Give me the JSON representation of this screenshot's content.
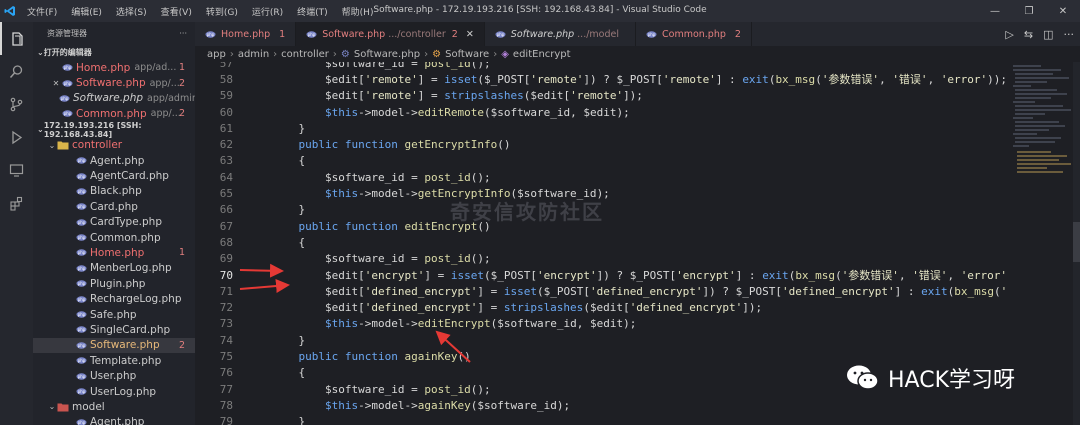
{
  "titlebar": {
    "menu": [
      "文件(F)",
      "编辑(E)",
      "选择(S)",
      "查看(V)",
      "转到(G)",
      "运行(R)",
      "终端(T)",
      "帮助(H)"
    ],
    "title": "Software.php - 172.19.193.216 [SSH: 192.168.43.84] - Visual Studio Code"
  },
  "sidebar": {
    "header": "资源管理器",
    "open_editors_label": "打开的编辑器",
    "open_editors": [
      {
        "name": "Home.php",
        "path": "app/ad...",
        "badge": "1",
        "state": "err"
      },
      {
        "name": "Software.php",
        "path": "app/...",
        "badge": "2",
        "state": "err",
        "close": "✕"
      },
      {
        "name": "Software.php",
        "path": "app/admin...",
        "badge": "",
        "state": "italic"
      },
      {
        "name": "Common.php",
        "path": "app/...",
        "badge": "2",
        "state": "err"
      }
    ],
    "workspace_label": "172.19.193.216 [SSH: 192.168.43.84]",
    "folder_controller": "controller",
    "files": [
      {
        "name": "Agent.php",
        "badge": "",
        "state": ""
      },
      {
        "name": "AgentCard.php",
        "badge": "",
        "state": ""
      },
      {
        "name": "Black.php",
        "badge": "",
        "state": ""
      },
      {
        "name": "Card.php",
        "badge": "",
        "state": ""
      },
      {
        "name": "CardType.php",
        "badge": "",
        "state": ""
      },
      {
        "name": "Common.php",
        "badge": "",
        "state": ""
      },
      {
        "name": "Home.php",
        "badge": "1",
        "state": "err"
      },
      {
        "name": "MenberLog.php",
        "badge": "",
        "state": ""
      },
      {
        "name": "Plugin.php",
        "badge": "",
        "state": ""
      },
      {
        "name": "RechargeLog.php",
        "badge": "",
        "state": ""
      },
      {
        "name": "Safe.php",
        "badge": "",
        "state": ""
      },
      {
        "name": "SingleCard.php",
        "badge": "",
        "state": ""
      },
      {
        "name": "Software.php",
        "badge": "2",
        "state": "mod sel"
      },
      {
        "name": "Template.php",
        "badge": "",
        "state": ""
      },
      {
        "name": "User.php",
        "badge": "",
        "state": ""
      },
      {
        "name": "UserLog.php",
        "badge": "",
        "state": ""
      }
    ],
    "folder_model": "model",
    "model_files": [
      {
        "name": "Agent.php",
        "badge": "",
        "state": ""
      }
    ]
  },
  "tabs": [
    {
      "name": "Home.php",
      "path": "",
      "num": "1",
      "active": false
    },
    {
      "name": "Software.php",
      "path": ".../controller",
      "num": "2",
      "active": true
    },
    {
      "name": "Software.php",
      "path": ".../model",
      "num": "",
      "active": false
    },
    {
      "name": "Common.php",
      "path": "",
      "num": "2",
      "active": false
    }
  ],
  "breadcrumb": [
    "app",
    "admin",
    "controller",
    "Software.php",
    "Software",
    "editEncrypt"
  ],
  "code": {
    "current_line": "70",
    "lines": [
      {
        "n": "57",
        "t": "        $software_id = post_id();"
      },
      {
        "n": "58",
        "t": "        $edit['remote'] = isset($_POST['remote']) ? $_POST['remote'] : exit(bx_msg('参数错误', '错误', 'error'));"
      },
      {
        "n": "59",
        "t": "        $edit['remote'] = stripslashes($edit['remote']);"
      },
      {
        "n": "60",
        "t": "        $this->model->editRemote($software_id, $edit);"
      },
      {
        "n": "61",
        "t": "    }"
      },
      {
        "n": "62",
        "t": "    public function getEncryptInfo()"
      },
      {
        "n": "63",
        "t": "    {"
      },
      {
        "n": "64",
        "t": "        $software_id = post_id();"
      },
      {
        "n": "65",
        "t": "        $this->model->getEncryptInfo($software_id);"
      },
      {
        "n": "66",
        "t": "    }"
      },
      {
        "n": "67",
        "t": "    public function editEncrypt()"
      },
      {
        "n": "68",
        "t": "    {"
      },
      {
        "n": "69",
        "t": "        $software_id = post_id();"
      },
      {
        "n": "70",
        "t": "        $edit['encrypt'] = isset($_POST['encrypt']) ? $_POST['encrypt'] : exit(bx_msg('参数错误', '错误', 'error'));"
      },
      {
        "n": "71",
        "t": "        $edit['defined_encrypt'] = isset($_POST['defined_encrypt']) ? $_POST['defined_encrypt'] : exit(bx_msg('参数错误', '错误"
      },
      {
        "n": "72",
        "t": "        $edit['defined_encrypt'] = stripslashes($edit['defined_encrypt']);"
      },
      {
        "n": "73",
        "t": "        $this->model->editEncrypt($software_id, $edit);"
      },
      {
        "n": "74",
        "t": "    }"
      },
      {
        "n": "75",
        "t": "    public function againKey()"
      },
      {
        "n": "76",
        "t": "    {"
      },
      {
        "n": "77",
        "t": "        $software_id = post_id();"
      },
      {
        "n": "78",
        "t": "        $this->model->againKey($software_id);"
      },
      {
        "n": "79",
        "t": "    }"
      }
    ]
  },
  "watermark": "奇安信攻防社区",
  "wechat_label": "HACK学习呀",
  "colors": {
    "error": "#e27f7f",
    "modified": "#e7b97a",
    "keyword": "#6aa6f0",
    "arrow": "#e53935"
  }
}
